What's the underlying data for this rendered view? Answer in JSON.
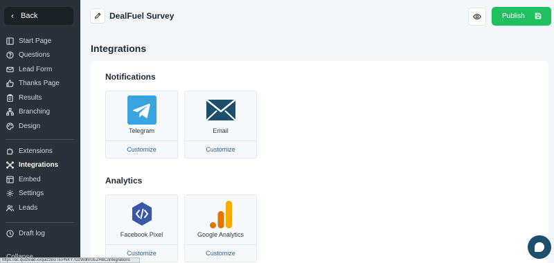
{
  "sidebar": {
    "back_label": "Back",
    "group1": [
      {
        "label": "Start Page",
        "icon": "layout-icon"
      },
      {
        "label": "Questions",
        "icon": "question-icon"
      },
      {
        "label": "Lead Form",
        "icon": "mail-icon"
      },
      {
        "label": "Thanks Page",
        "icon": "thumbs-up-icon"
      },
      {
        "label": "Results",
        "icon": "clipboard-icon"
      },
      {
        "label": "Branching",
        "icon": "branch-icon"
      },
      {
        "label": "Design",
        "icon": "palette-icon"
      }
    ],
    "group2": [
      {
        "label": "Extensions",
        "icon": "puzzle-icon"
      },
      {
        "label": "Integrations",
        "icon": "integrations-icon",
        "active": true
      },
      {
        "label": "Embed",
        "icon": "embed-icon"
      },
      {
        "label": "Settings",
        "icon": "gear-icon"
      },
      {
        "label": "Leads",
        "icon": "users-icon"
      }
    ],
    "group3": [
      {
        "label": "Draft log",
        "icon": "clock-icon"
      }
    ],
    "cutoff_label": "Collapse"
  },
  "header": {
    "survey_title": "DealFuel Survey",
    "publish_label": "Publish"
  },
  "page_title": "Integrations",
  "sections": {
    "notifications": {
      "title": "Notifications",
      "cards": [
        {
          "name": "Telegram",
          "action": "Customize",
          "icon": "telegram-logo"
        },
        {
          "name": "Email",
          "action": "Customize",
          "icon": "email-envelope-logo"
        }
      ]
    },
    "analytics": {
      "title": "Analytics",
      "cards": [
        {
          "name": "Facebook Pixel",
          "action": "Customize",
          "icon": "facebook-pixel-logo"
        },
        {
          "name": "Google Analytics",
          "action": "Customize",
          "icon": "google-analytics-logo"
        }
      ]
    }
  },
  "status_url": "https://ac.quizlead.io/quizzes/TEPNKY7DzWdhrUEZHBC/integrations",
  "colors": {
    "sidebar_bg": "#2b3138",
    "publish_green": "#20c060",
    "link_blue": "#2e5f86",
    "chat_button": "#1d4e6b"
  }
}
